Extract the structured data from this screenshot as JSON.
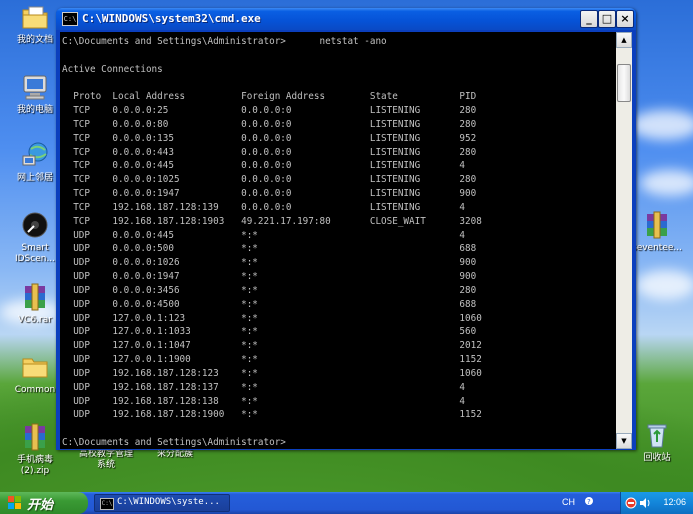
{
  "window": {
    "title": "C:\\WINDOWS\\system32\\cmd.exe",
    "icon_text": "C:\\",
    "minimize": "_",
    "maximize": "□",
    "close": "×"
  },
  "console": {
    "prompt": "C:\\Documents and Settings\\Administrator>",
    "command": "netstat -ano",
    "heading": "Active Connections",
    "columns": [
      "Proto",
      "Local Address",
      "Foreign Address",
      "State",
      "PID"
    ],
    "rows": [
      [
        "TCP",
        "0.0.0.0:25",
        "0.0.0.0:0",
        "LISTENING",
        "280"
      ],
      [
        "TCP",
        "0.0.0.0:80",
        "0.0.0.0:0",
        "LISTENING",
        "280"
      ],
      [
        "TCP",
        "0.0.0.0:135",
        "0.0.0.0:0",
        "LISTENING",
        "952"
      ],
      [
        "TCP",
        "0.0.0.0:443",
        "0.0.0.0:0",
        "LISTENING",
        "280"
      ],
      [
        "TCP",
        "0.0.0.0:445",
        "0.0.0.0:0",
        "LISTENING",
        "4"
      ],
      [
        "TCP",
        "0.0.0.0:1025",
        "0.0.0.0:0",
        "LISTENING",
        "280"
      ],
      [
        "TCP",
        "0.0.0.0:1947",
        "0.0.0.0:0",
        "LISTENING",
        "900"
      ],
      [
        "TCP",
        "192.168.187.128:139",
        "0.0.0.0:0",
        "LISTENING",
        "4"
      ],
      [
        "TCP",
        "192.168.187.128:1903",
        "49.221.17.197:80",
        "CLOSE_WAIT",
        "3208"
      ],
      [
        "UDP",
        "0.0.0.0:445",
        "*:*",
        "",
        "4"
      ],
      [
        "UDP",
        "0.0.0.0:500",
        "*:*",
        "",
        "688"
      ],
      [
        "UDP",
        "0.0.0.0:1026",
        "*:*",
        "",
        "900"
      ],
      [
        "UDP",
        "0.0.0.0:1947",
        "*:*",
        "",
        "900"
      ],
      [
        "UDP",
        "0.0.0.0:3456",
        "*:*",
        "",
        "280"
      ],
      [
        "UDP",
        "0.0.0.0:4500",
        "*:*",
        "",
        "688"
      ],
      [
        "UDP",
        "127.0.0.1:123",
        "*:*",
        "",
        "1060"
      ],
      [
        "UDP",
        "127.0.0.1:1033",
        "*:*",
        "",
        "560"
      ],
      [
        "UDP",
        "127.0.0.1:1047",
        "*:*",
        "",
        "2012"
      ],
      [
        "UDP",
        "127.0.0.1:1900",
        "*:*",
        "",
        "1152"
      ],
      [
        "UDP",
        "192.168.187.128:123",
        "*:*",
        "",
        "1060"
      ],
      [
        "UDP",
        "192.168.187.128:137",
        "*:*",
        "",
        "4"
      ],
      [
        "UDP",
        "192.168.187.128:138",
        "*:*",
        "",
        "4"
      ],
      [
        "UDP",
        "192.168.187.128:1900",
        "*:*",
        "",
        "1152"
      ]
    ],
    "end_prompt": "C:\\Documents and Settings\\Administrator>"
  },
  "desktop": {
    "icons_left": [
      {
        "name": "my-documents",
        "label": "我的文档",
        "icon": "folder-documents-icon"
      },
      {
        "name": "my-computer",
        "label": "我的电脑",
        "icon": "computer-icon"
      },
      {
        "name": "network-places",
        "label": "网上邻居",
        "icon": "network-icon"
      },
      {
        "name": "smart-idscen",
        "label": "Smart\nIDScen...",
        "icon": "disc-icon"
      },
      {
        "name": "vc6-rar",
        "label": "VC6.rar",
        "icon": "rar-archive-icon"
      },
      {
        "name": "common",
        "label": "Common",
        "icon": "folder-icon"
      },
      {
        "name": "mobile-virus-zip",
        "label": "手机病毒\n(2).zip",
        "icon": "rar-archive-icon"
      }
    ],
    "icons_bottom": [
      {
        "name": "school-system",
        "label": "高校教学管理\n系统"
      },
      {
        "name": "grade-system",
        "label": "采分配簇"
      }
    ],
    "icons_right": [
      {
        "name": "seventeen",
        "label": "seventee...",
        "icon": "rar-archive-icon"
      },
      {
        "name": "recycle-bin",
        "label": "回收站",
        "icon": "recycle-bin-icon"
      }
    ]
  },
  "taskbar": {
    "start_label": "开始",
    "task_label": "C:\\WINDOWS\\syste...",
    "language": "CH",
    "time": "12:06"
  },
  "colors": {
    "console_bg": "#000000",
    "console_fg": "#c0c0c0",
    "titlebar": "#0652d6",
    "taskbar": "#245edb",
    "start": "#3a9a34"
  }
}
